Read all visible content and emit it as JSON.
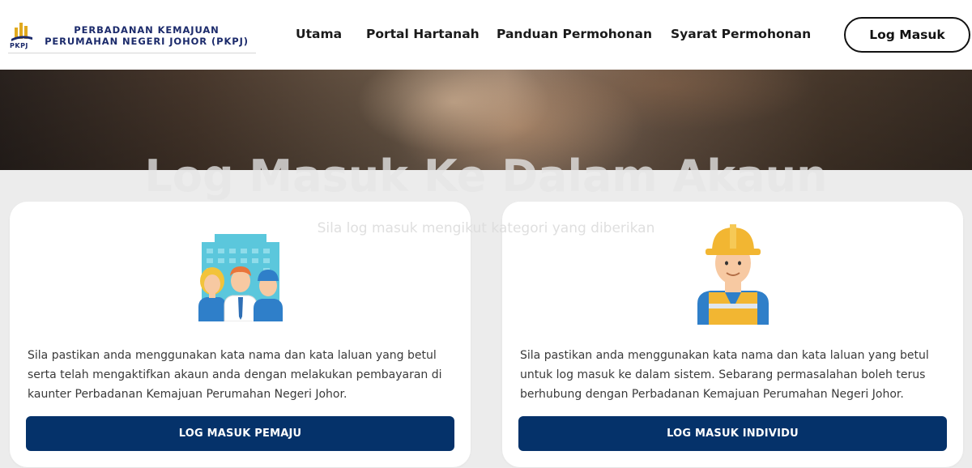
{
  "header": {
    "org_name": "PERBADANAN KEMAJUAN PERUMAHAN NEGERI JOHOR (PKPJ)",
    "logo_abbr": "PKPJ",
    "nav": [
      {
        "label": "Utama"
      },
      {
        "label": "Portal Hartanah"
      },
      {
        "label": "Panduan Permohonan"
      },
      {
        "label": "Syarat Permohonan"
      }
    ],
    "login_label": "Log Masuk"
  },
  "page": {
    "title": "Log Masuk Ke Dalam Akaun",
    "subtitle": "Sila log masuk mengikut kategori yang diberikan"
  },
  "cards": [
    {
      "illustration": "business-team-icon",
      "text": "Sila pastikan anda menggunakan kata nama dan kata laluan yang betul serta telah mengaktifkan akaun anda dengan melakukan pembayaran di kaunter Perbadanan Kemajuan Perumahan Negeri Johor.",
      "button_label": "LOG MASUK PEMAJU"
    },
    {
      "illustration": "construction-worker-icon",
      "text": "Sila pastikan anda menggunakan kata nama dan kata laluan yang betul untuk log masuk ke dalam sistem. Sebarang permasalahan boleh terus berhubung dengan Perbadanan Kemajuan Perumahan Negeri Johor.",
      "button_label": "LOG MASUK INDIVIDU"
    }
  ],
  "colors": {
    "primary_button": "#05326a",
    "brand_navy": "#1b2a6b",
    "logo_gold": "#e0a91f"
  }
}
